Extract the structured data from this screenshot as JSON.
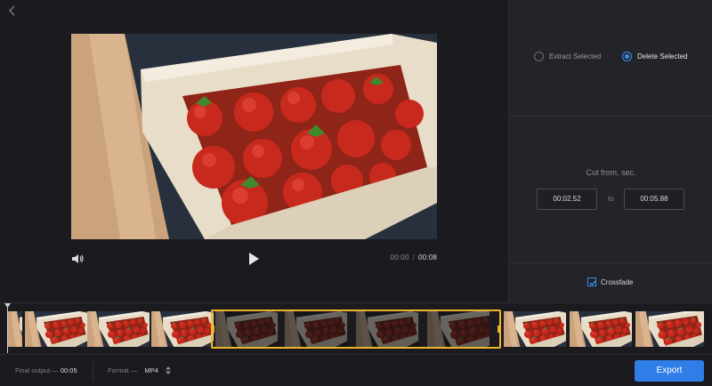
{
  "player": {
    "current_time": "00:00",
    "time_separator": "/",
    "total_time": "00:08"
  },
  "panel": {
    "mode_options": [
      {
        "label": "Extract Selected",
        "selected": false
      },
      {
        "label": "Delete Selected",
        "selected": true
      }
    ],
    "cut_title": "Cut from, sec.",
    "cut_from": "00:02.52",
    "cut_to": "00:05.88",
    "to_label": "to",
    "crossfade_label": "Crossfade",
    "crossfade_checked": true
  },
  "timeline": {
    "thumbnail_count": 10,
    "selected_range_fraction": [
      0.3,
      0.71
    ]
  },
  "footer": {
    "final_output_label": "Final output —",
    "final_output_value": "00:05",
    "format_label": "Format —",
    "format_value": "MP4",
    "export_label": "Export"
  },
  "colors": {
    "accent": "#2f7de6",
    "selection": "#f0b429",
    "background": "#1b1b1f",
    "panel": "#232429"
  },
  "icons": [
    "back-chevron-icon",
    "volume-icon",
    "play-icon",
    "sort-arrows-icon",
    "checkmark-icon"
  ]
}
